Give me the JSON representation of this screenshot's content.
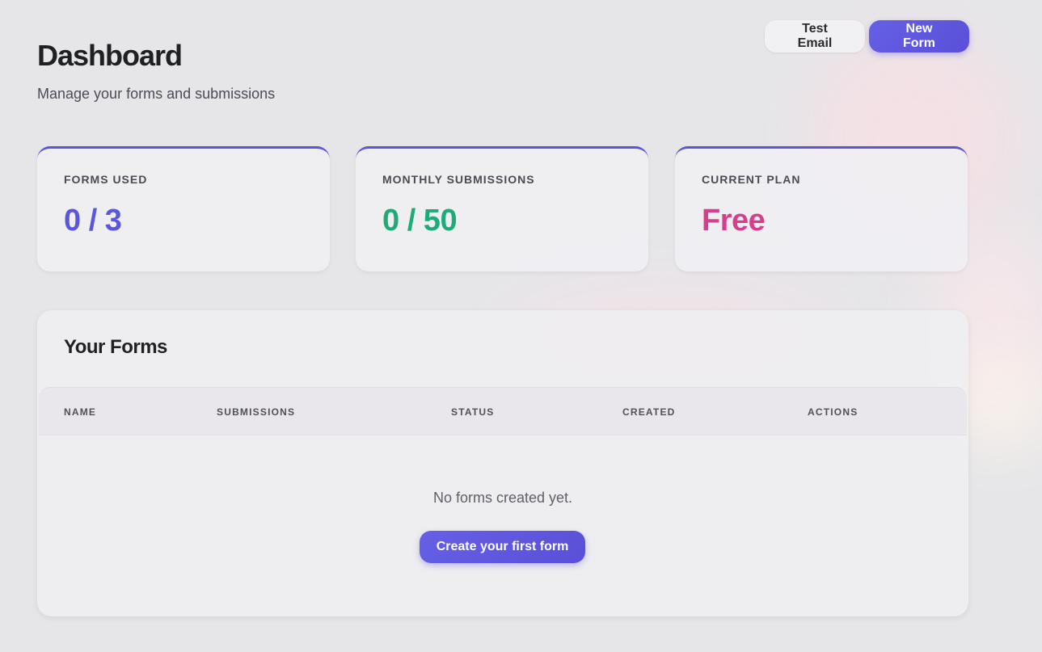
{
  "header": {
    "title": "Dashboard",
    "subtitle": "Manage your forms and submissions",
    "actions": {
      "test_email_label": "Test Email",
      "new_form_label": "New Form"
    }
  },
  "stats": {
    "forms_used": {
      "label": "FORMS USED",
      "value": "0 / 3",
      "color": "#5b57dc"
    },
    "monthly_submissions": {
      "label": "MONTHLY SUBMISSIONS",
      "value": "0 / 50",
      "color": "#1eab78"
    },
    "current_plan": {
      "label": "CURRENT PLAN",
      "value": "Free",
      "color": "#d63f8c"
    }
  },
  "forms_panel": {
    "title": "Your Forms",
    "columns": [
      "NAME",
      "SUBMISSIONS",
      "STATUS",
      "CREATED",
      "ACTIONS"
    ],
    "rows": [],
    "empty_message": "No forms created yet.",
    "create_button_label": "Create your first form"
  },
  "colors": {
    "accent": "#5b54db"
  }
}
